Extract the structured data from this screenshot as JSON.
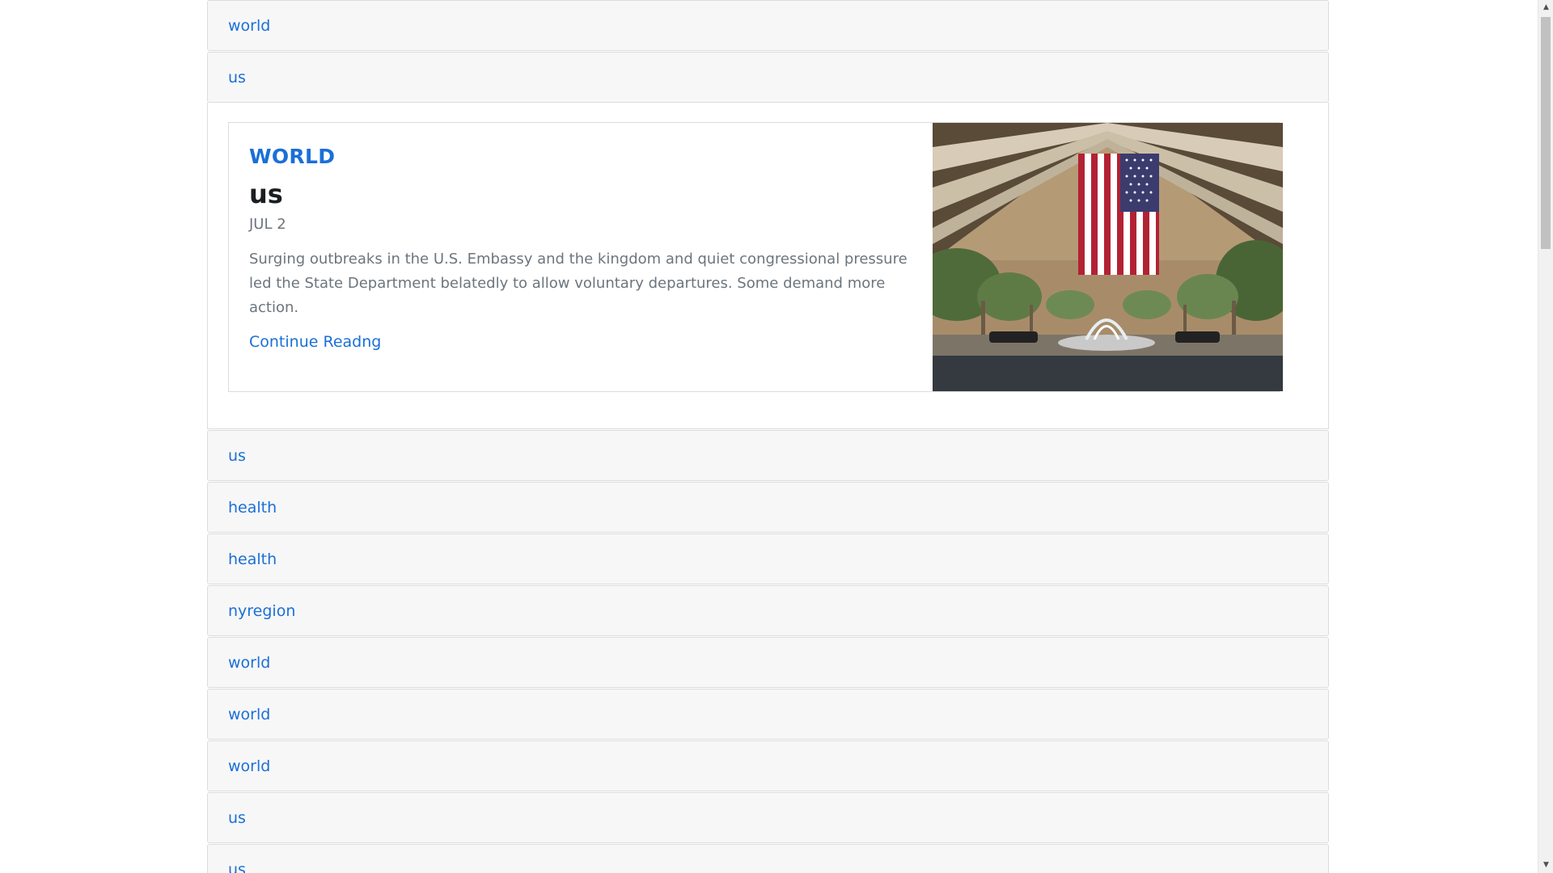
{
  "accordion": {
    "items_before": [
      {
        "label": "world"
      },
      {
        "label": "us"
      }
    ],
    "expanded": {
      "category": "WORLD",
      "title": "us",
      "date": "JUL 2",
      "summary": "Surging outbreaks in the U.S. Embassy and the kingdom and quiet congressional pressure led the State Department belatedly to allow voluntary departures. Some demand more action.",
      "read_more": "Continue Readng",
      "image_icon": "flag-photo"
    },
    "items_after": [
      {
        "label": "us"
      },
      {
        "label": "health"
      },
      {
        "label": "health"
      },
      {
        "label": "nyregion"
      },
      {
        "label": "world"
      },
      {
        "label": "world"
      },
      {
        "label": "world"
      },
      {
        "label": "us"
      },
      {
        "label": "us"
      }
    ]
  },
  "colors": {
    "link": "#1a6fd8",
    "header_bg": "#f7f7f7",
    "muted_text": "#6c757d",
    "image_footer": "#343a40"
  },
  "scrollbar": {
    "up_icon": "chevron-up-icon",
    "down_icon": "chevron-down-icon"
  }
}
